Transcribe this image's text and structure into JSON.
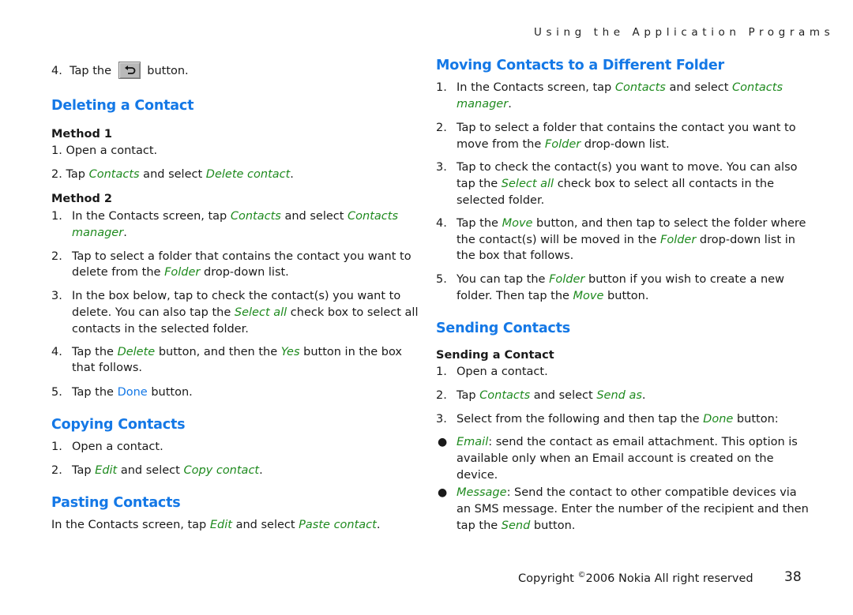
{
  "header": {
    "running_title": "Using the Application Programs"
  },
  "left": {
    "step4": {
      "num": "4.",
      "pre": "Tap the",
      "post": "button.",
      "icon": "back-arrow-icon"
    },
    "deleting": {
      "title": "Deleting a Contact",
      "method1": {
        "title": "Method 1",
        "s1": "1. Open a contact.",
        "s2": {
          "pre": "2. Tap ",
          "a": "Contacts",
          "mid": " and select ",
          "b": "Delete contact",
          "end": "."
        }
      },
      "method2": {
        "title": "Method 2",
        "s1": {
          "num": "1.",
          "pre": "In the Contacts screen, tap ",
          "a": "Contacts",
          "mid": " and select ",
          "b": "Contacts",
          "b2": "manager",
          "end": "."
        },
        "s2": {
          "num": "2.",
          "l1": "Tap to select a folder that contains the contact you want to",
          "l2pre": "delete from the ",
          "a": "Folder",
          "l2post": " drop-down list."
        },
        "s3": {
          "num": "3.",
          "l1": "In the box below, tap to check the contact(s) you want to",
          "l2pre": "delete. You can also tap the ",
          "a": "Select all",
          "l2post": " check box to select all",
          "l3": "contacts in the selected folder."
        },
        "s4": {
          "num": "4.",
          "pre": "Tap the ",
          "a": "Delete",
          "mid": " button, and then the ",
          "b": "Yes",
          "post": " button in the box",
          "l2": "that follows."
        },
        "s5": {
          "num": "5.",
          "pre": "Tap the ",
          "a": "Done",
          "post": " button."
        }
      }
    },
    "copying": {
      "title": "Copying Contacts",
      "s1": {
        "num": "1.",
        "text": "Open a contact."
      },
      "s2": {
        "num": "2.",
        "pre": "Tap ",
        "a": "Edit",
        "mid": " and select ",
        "b": "Copy contact",
        "end": "."
      }
    },
    "pasting": {
      "title": "Pasting Contacts",
      "text": {
        "pre": "In the Contacts screen, tap ",
        "a": "Edit",
        "mid": " and select ",
        "b": "Paste contact",
        "end": "."
      }
    }
  },
  "right": {
    "moving": {
      "title": "Moving Contacts to a Different Folder",
      "s1": {
        "num": "1.",
        "pre": "In the Contacts screen, tap ",
        "a": "Contacts",
        "mid": " and select ",
        "b": "Contacts",
        "b2": "manager",
        "end": "."
      },
      "s2": {
        "num": "2.",
        "l1": "Tap to select a folder that contains the contact you want to",
        "l2pre": "move from the ",
        "a": "Folder",
        "l2post": " drop-down list."
      },
      "s3": {
        "num": "3.",
        "l1": "Tap to check the contact(s) you want to move. You can also",
        "l2pre": "tap the ",
        "a": "Select all",
        "l2post": " check box to select all contacts in the",
        "l3": "selected folder."
      },
      "s4": {
        "num": "4.",
        "pre": "Tap the ",
        "a": "Move",
        "post": " button, and then tap to select the folder where",
        "l2pre": "the contact(s) will be moved in the ",
        "b": "Folder",
        "l2post": " drop-down list in",
        "l3": "the box that follows."
      },
      "s5": {
        "num": "5.",
        "pre": "You can tap the ",
        "a": "Folder",
        "post": " button if you wish to create a new",
        "l2pre": "folder. Then tap the ",
        "b": "Move",
        "l2post": " button."
      }
    },
    "sending": {
      "title": "Sending Contacts",
      "sub": "Sending a Contact",
      "s1": {
        "num": "1.",
        "text": "Open a contact."
      },
      "s2": {
        "num": "2.",
        "pre": "Tap ",
        "a": "Contacts",
        "mid": " and select ",
        "b": "Send as",
        "end": "."
      },
      "s3": {
        "num": "3.",
        "pre": "Select from the following and then tap the ",
        "a": "Done",
        "post": " button:"
      },
      "b1": {
        "a": "Email",
        "l1": ": send the contact as email attachment. This option is",
        "l2": "available only when an Email account is created on the",
        "l3": "device."
      },
      "b2": {
        "a": "Message",
        "l1": ": Send the contact to other compatible devices via",
        "l2": "an SMS message. Enter the number of the recipient and then",
        "l3pre": "tap the ",
        "b": "Send",
        "l3post": " button."
      }
    }
  },
  "footer": {
    "copyright_pre": "Copyright ",
    "copyright_symbol": "©",
    "copyright_post": "2006 Nokia All right reserved",
    "page_number": "38"
  },
  "colors": {
    "heading": "#1478e6",
    "ui_term": "#1e8a1e",
    "text": "#1a1a1a"
  }
}
